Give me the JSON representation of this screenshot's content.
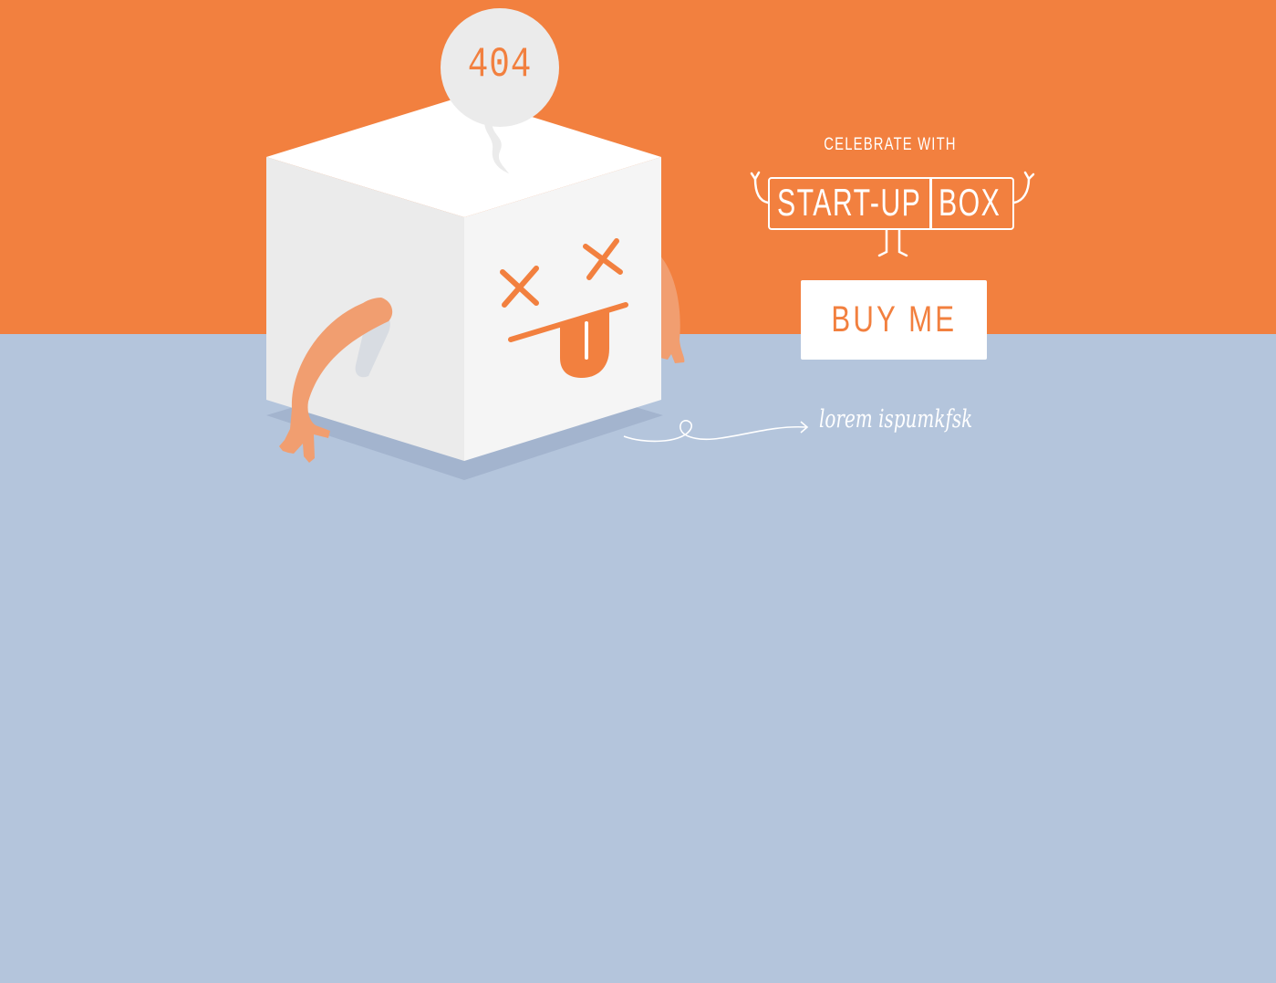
{
  "colors": {
    "orange": "#f2803f",
    "blue_grey": "#b4c5dc",
    "white": "#ffffff",
    "arm": "#f19e70",
    "bubble": "#ebebeb",
    "cube_left": "#ebebeb",
    "cube_right": "#f5f5f5",
    "shadow": "#a3b4ce"
  },
  "error": {
    "code": "404"
  },
  "promo": {
    "tagline": "CELEBRATE WITH",
    "logo_word_1": "START-UP",
    "logo_word_2": "BOX",
    "buy_button_label": "BUY ME"
  },
  "annotation": {
    "text": "lorem ispumkfsk"
  },
  "icons": {
    "mascot": "dizzy-box-character-icon",
    "speech_bubble": "speech-bubble-icon",
    "logo_mascot": "logo-character-icon",
    "arrow": "curly-arrow-icon"
  }
}
